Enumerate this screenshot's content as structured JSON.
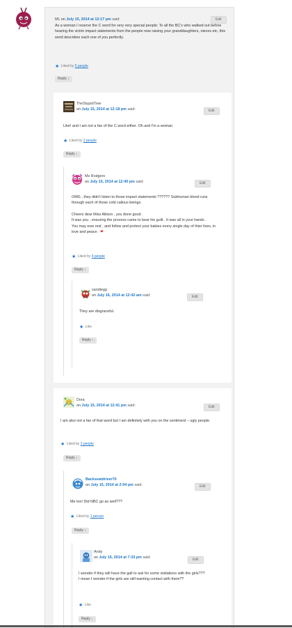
{
  "comments": {
    "c1": {
      "author": "ML",
      "on": "on",
      "date": "July 15, 2014 at 12:17 pm",
      "said": "said:",
      "edit": "Edit",
      "body": "As a woman I reserve the C word for very very special people; To all the BC's who walked out before hearing the victim impact statements from the people now raising your granddaughters, nieces etc, this word describes each one of you perfectly.",
      "liked_prefix": "Liked by",
      "liked_link": "5 people",
      "reply": "Reply ↓"
    },
    "c2": {
      "author": "TheStupidTree",
      "on": "on",
      "date": "July 15, 2014 at 12:18 pm",
      "said": "said:",
      "edit": "Edit",
      "body": "Like! and I am not a fan of the C word either. Oh and I'm a woman",
      "liked_prefix": "Liked by",
      "liked_link": "2 people",
      "reply": "Reply ↓"
    },
    "c3": {
      "author": "Ms Rodgers",
      "on": "on",
      "date": "July 15, 2014 at 12:40 pm",
      "said": "said:",
      "edit": "Edit",
      "body_p1": "OMG , they didn't listen to those impact statements ?????? Subhuman blood runs through each of those cold callous beings.",
      "body_p2a": "Cheers dear Miss Allison , you done good .",
      "body_p2b": "It was you , ensuring the process came to bear his guilt . It was all in your hands .",
      "body_p2c": "You may now rest , and follow and protect your babies every single day of thier lives, in love and peace .",
      "heart": "❤",
      "liked_prefix": "Liked by",
      "liked_link": "4 people",
      "reply": "Reply ↓"
    },
    "c4": {
      "author": "sandiegg",
      "on": "on",
      "date": "July 16, 2014 at 12:42 am",
      "said": "said:",
      "edit": "Edit",
      "body": "They are disgraceful.",
      "like": "Like",
      "reply": "Reply ↓"
    },
    "c5": {
      "author": "Dora",
      "on": "on",
      "date": "July 15, 2014 at 12:41 pm",
      "said": "said:",
      "edit": "Edit",
      "body": "I am also not a fan of that word but I am definitely with you on the sentiment – ugly people.",
      "liked_prefix": "Liked by",
      "liked_link": "2 people",
      "reply": "Reply ↓"
    },
    "c6": {
      "author": "Backseatdriver70",
      "on": "on",
      "date": "July 15, 2014 at 2:04 pm",
      "said": "said:",
      "edit": "Edit",
      "body": "Me too! Did NBC go as well???",
      "liked_prefix": "Liked by",
      "liked_link": "1 person",
      "reply": "Reply ↓"
    },
    "c7": {
      "author": "Andy",
      "on": "on",
      "date": "July 15, 2014 at 7:33 pm",
      "said": "said:",
      "edit": "Edit",
      "body": "I wonder if they will have the gall to ask for some visitations with the girls??? I mean I wonder if the girls are still wanting contact with them??",
      "like": "Like",
      "reply": "Reply ↓"
    }
  },
  "colors": {
    "link": "#1a75c9",
    "panel": "#f2f2f2",
    "heart": "#d52a2a"
  }
}
